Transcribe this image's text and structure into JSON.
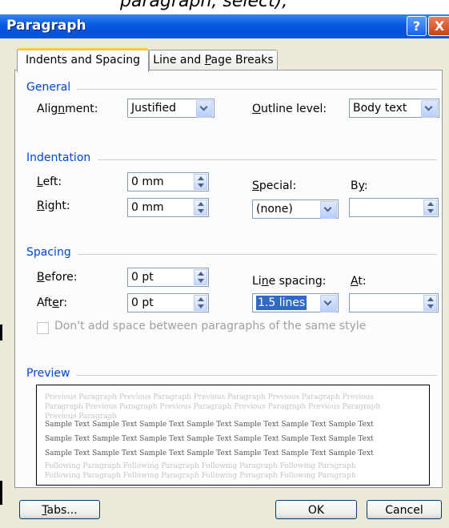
{
  "window": {
    "title": "Paragraph",
    "help_glyph": "?",
    "close_glyph": "X"
  },
  "behind_text": "paragraph, select),",
  "tabs": [
    {
      "label": "Indents and Spacing",
      "active": true
    },
    {
      "label": "Line and Page Breaks",
      "active": false
    }
  ],
  "general": {
    "heading": "General",
    "alignment_label": "Alignment:",
    "alignment_value": "Justified",
    "outline_label": "Outline level:",
    "outline_value": "Body text"
  },
  "indentation": {
    "heading": "Indentation",
    "left_label": "Left:",
    "left_value": "0 mm",
    "right_label": "Right:",
    "right_value": "0 mm",
    "special_label": "Special:",
    "special_value": "(none)",
    "by_label": "By:",
    "by_value": ""
  },
  "spacing": {
    "heading": "Spacing",
    "before_label": "Before:",
    "before_value": "0 pt",
    "after_label": "After:",
    "after_value": "0 pt",
    "line_spacing_label": "Line spacing:",
    "line_spacing_value": "1.5 lines",
    "at_label": "At:",
    "at_value": "",
    "no_space_label": "Don't add space between paragraphs of the same style",
    "no_space_checked": false
  },
  "preview": {
    "heading": "Preview",
    "previous_lines": [
      "Previous Paragraph Previous Paragraph Previous Paragraph Previous Paragraph Previous",
      "Paragraph Previous Paragraph Previous Paragraph Previous Paragraph Previous Paragraph",
      "Previous Paragraph"
    ],
    "sample_lines": [
      "Sample Text Sample Text Sample Text Sample Text Sample Text Sample Text Sample Text",
      "Sample Text Sample Text Sample Text Sample Text Sample Text Sample Text Sample Text",
      "Sample Text Sample Text Sample Text Sample Text Sample Text Sample Text Sample Text"
    ],
    "following_lines": [
      "Following Paragraph Following Paragraph Following Paragraph Following Paragraph",
      "Following Paragraph Following Paragraph Following Paragraph Following Paragraph"
    ]
  },
  "buttons": {
    "tabs": "Tabs...",
    "ok": "OK",
    "cancel": "Cancel"
  },
  "colors": {
    "titlebar": "#0a5ce4",
    "group_heading": "#0046d5",
    "dialog_bg": "#ece9d8",
    "selection": "#316ac5"
  },
  "icons": {
    "help": "help-icon",
    "close": "close-icon",
    "dropdown": "chevron-down-icon",
    "spinner": "spinner-icon"
  }
}
